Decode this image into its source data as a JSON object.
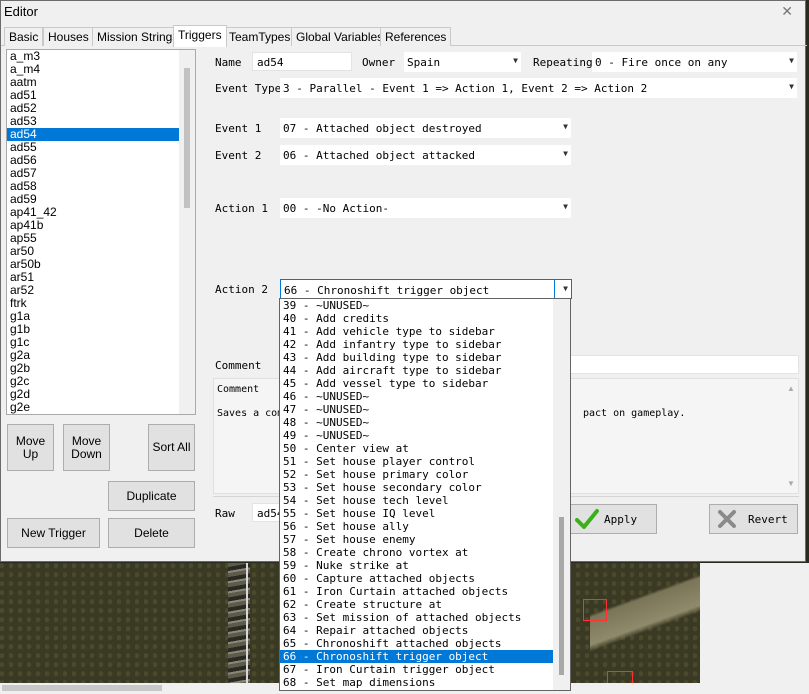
{
  "window": {
    "title": "Editor",
    "close_glyph": "✕"
  },
  "tabs": [
    {
      "label": "Basic"
    },
    {
      "label": "Houses"
    },
    {
      "label": "Mission Strings"
    },
    {
      "label": "Triggers"
    },
    {
      "label": "TeamTypes"
    },
    {
      "label": "Global Variables"
    },
    {
      "label": "References"
    }
  ],
  "active_tab": "Triggers",
  "trigger_list": {
    "items": [
      "a_m3",
      "a_m4",
      "aatm",
      "ad51",
      "ad52",
      "ad53",
      "ad54",
      "ad55",
      "ad56",
      "ad57",
      "ad58",
      "ad59",
      "ap41_42",
      "ap41b",
      "ap55",
      "ar50",
      "ar50b",
      "ar51",
      "ar52",
      "ftrk",
      "g1a",
      "g1b",
      "g1c",
      "g2a",
      "g2b",
      "g2c",
      "g2d",
      "g2e"
    ],
    "selected": "ad54"
  },
  "buttons": {
    "move_up": "Move\nUp",
    "move_down": "Move\nDown",
    "sort_all": "Sort All",
    "duplicate": "Duplicate",
    "new_trigger": "New Trigger",
    "delete": "Delete",
    "apply": "Apply",
    "revert": "Revert"
  },
  "form": {
    "name_label": "Name",
    "name_value": "ad54",
    "owner_label": "Owner",
    "owner_value": "Spain",
    "repeating_label": "Repeating",
    "repeating_value": "0 - Fire once on any",
    "event_type_label": "Event Type",
    "event_type_value": "3 - Parallel - Event 1 => Action 1, Event 2 => Action 2",
    "event1_label": "Event 1",
    "event1_value": "07 - Attached object destroyed",
    "event2_label": "Event 2",
    "event2_value": "06 - Attached object attacked",
    "action1_label": "Action 1",
    "action1_value": "00 - -No Action-",
    "action2_label": "Action 2",
    "action2_value": "66 - Chronoshift trigger object",
    "comment_label": "Comment",
    "comment_header": "Comment",
    "comment_desc_left": "Saves a comme",
    "comment_desc_right": "pact on gameplay.",
    "raw_label": "Raw",
    "raw_value": "ad54"
  },
  "action2_options": [
    "39 - ~UNUSED~",
    "40 - Add credits",
    "41 - Add vehicle type to sidebar",
    "42 - Add infantry type to sidebar",
    "43 - Add building type to sidebar",
    "44 - Add aircraft type to sidebar",
    "45 - Add vessel type to sidebar",
    "46 - ~UNUSED~",
    "47 - ~UNUSED~",
    "48 - ~UNUSED~",
    "49 - ~UNUSED~",
    "50 - Center view at",
    "51 - Set house player control",
    "52 - Set house primary color",
    "53 - Set house secondary color",
    "54 - Set house tech level",
    "55 - Set house IQ level",
    "56 - Set house ally",
    "57 - Set house enemy",
    "58 - Create chrono vortex at",
    "59 - Nuke strike at",
    "60 - Capture attached objects",
    "61 - Iron Curtain attached objects",
    "62 - Create structure at",
    "63 - Set mission of attached objects",
    "64 - Repair attached objects",
    "65 - Chronoshift attached objects",
    "66 - Chronoshift trigger object",
    "67 - Iron Curtain trigger object",
    "68 - Set map dimensions"
  ],
  "action2_selected": "66 - Chronoshift trigger object",
  "colors": {
    "selection": "#0078d7",
    "apply_check": "#3cb019",
    "revert_x": "#8a8a8a"
  }
}
